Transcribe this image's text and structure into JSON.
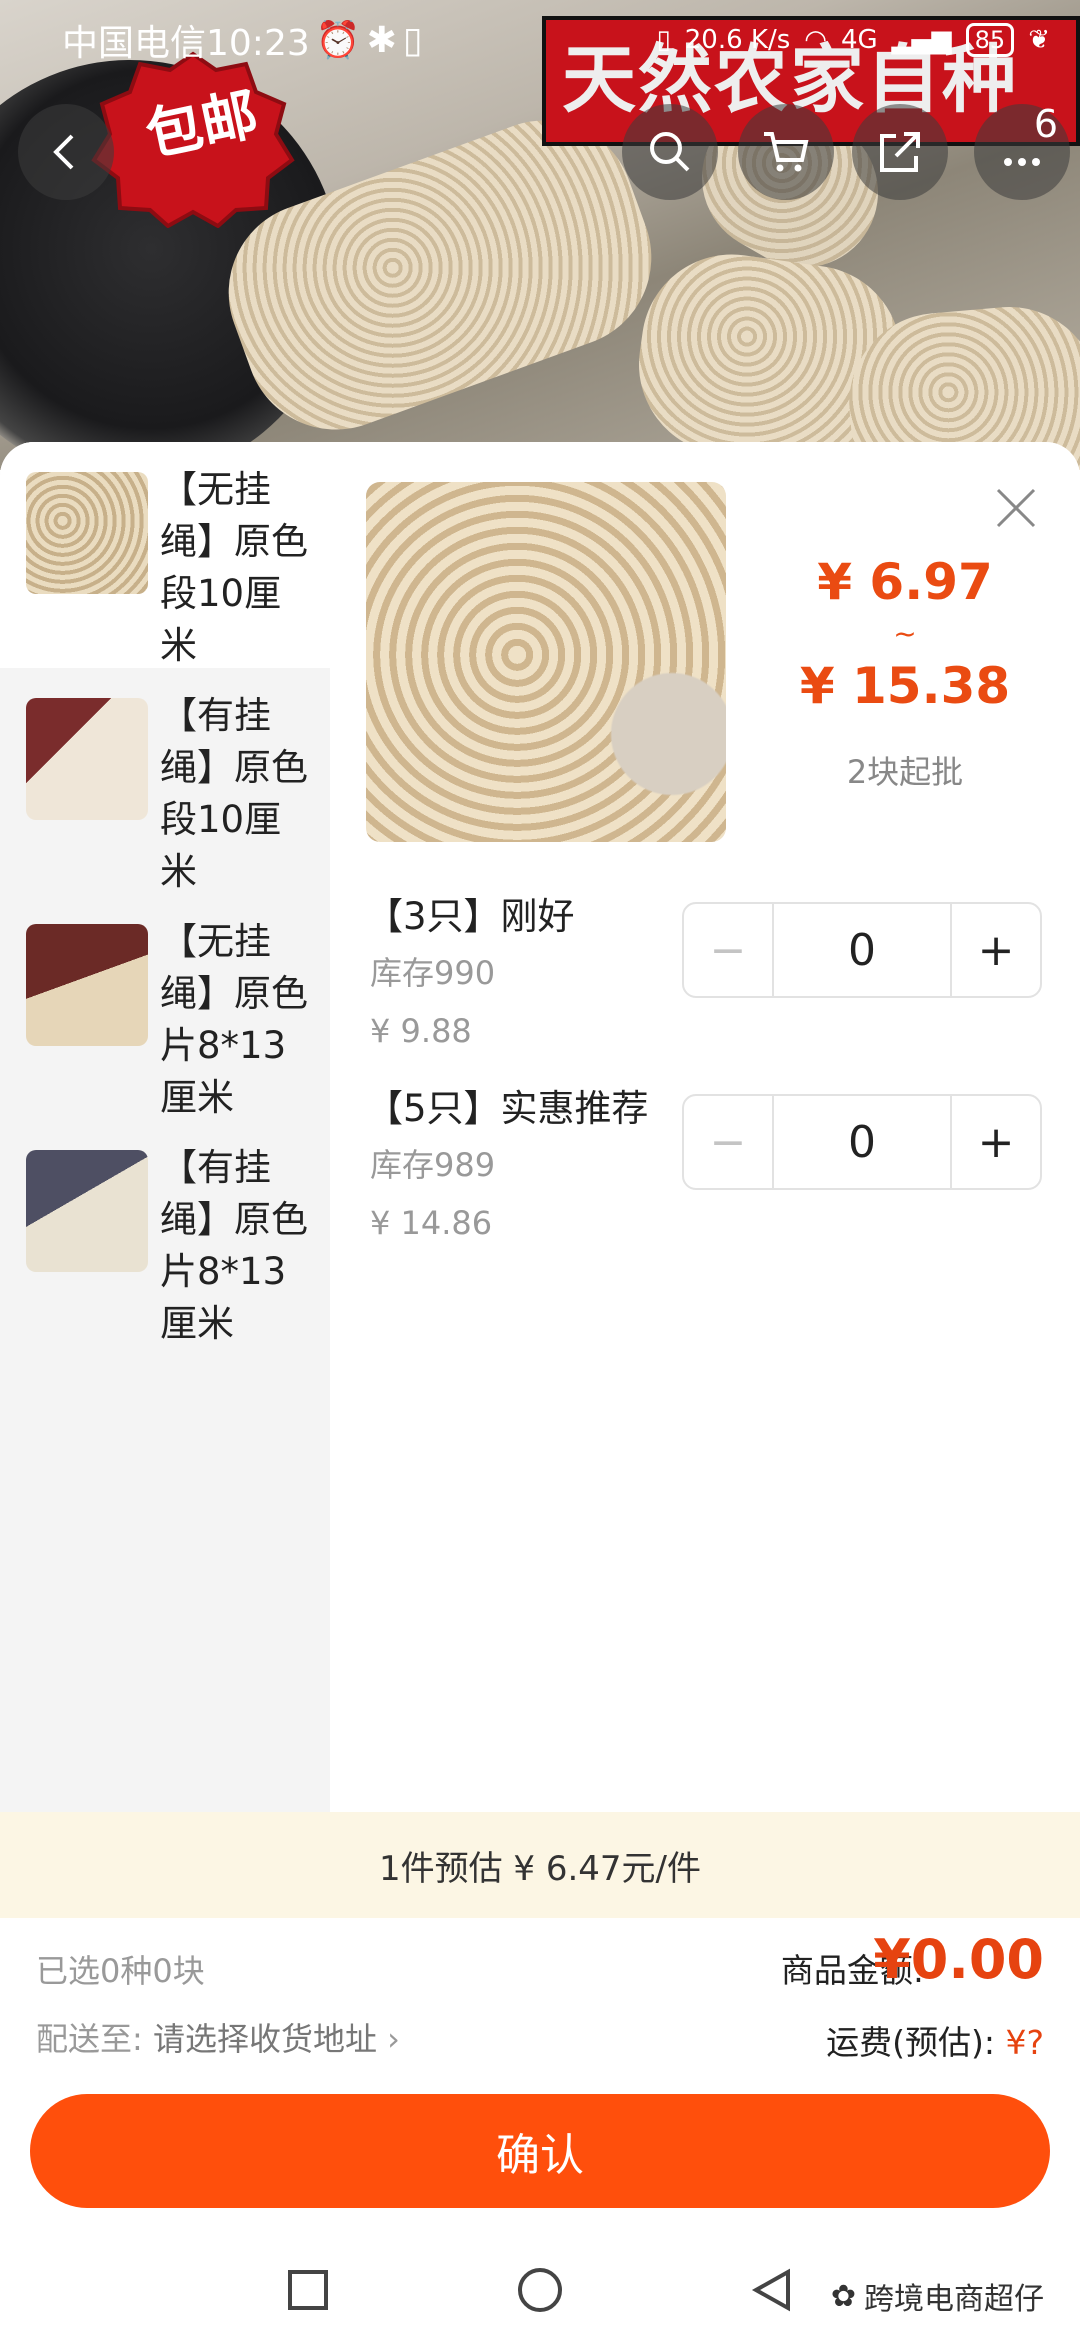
{
  "status_bar": {
    "carrier_time": "中国电信10:23",
    "net_speed": "20.6 K/s",
    "network": "4G",
    "battery": "85"
  },
  "hero": {
    "promo_banner": "天然农家自种",
    "badge": "包邮",
    "cart_count": "6"
  },
  "variants_sidebar": [
    {
      "label": "【无挂绳】原色段10厘米",
      "icon": "loofah-pile-thumb"
    },
    {
      "label": "【有挂绳】原色段10厘米",
      "icon": "loofah-rope-thumb"
    },
    {
      "label": "【无挂绳】原色片8*13厘米",
      "icon": "loofah-slice-thumb"
    },
    {
      "label": "【有挂绳】原色片8*13厘米",
      "icon": "loofah-slice-rope-thumb"
    }
  ],
  "price": {
    "low": "¥ 6.97",
    "separator": "~",
    "high": "¥ 15.38",
    "min_order": "2块起批"
  },
  "options": [
    {
      "name": "【3只】刚好",
      "stock": "库存990",
      "price": "¥ 9.88",
      "qty": "0",
      "minus": "−",
      "plus": "+"
    },
    {
      "name": "【5只】实惠推荐",
      "stock": "库存989",
      "price": "¥ 14.86",
      "qty": "0",
      "minus": "−",
      "plus": "+"
    }
  ],
  "estimate": "1件预估 ¥ 6.47元/件",
  "summary": {
    "selected": "已选0种0块",
    "total_label": "商品金额:",
    "total_value": "¥0.00",
    "ship_to_label": "配送至:",
    "ship_to_value": "请选择收货地址",
    "freight_label": "运费(预估):",
    "freight_value": "¥?"
  },
  "confirm_label": "确认",
  "watermark": "跨境电商超仔",
  "colors": {
    "accent": "#ff4f0c",
    "price": "#ea4b12",
    "estimate_bg": "#fcf6e4",
    "banner_red": "#c8121b"
  }
}
